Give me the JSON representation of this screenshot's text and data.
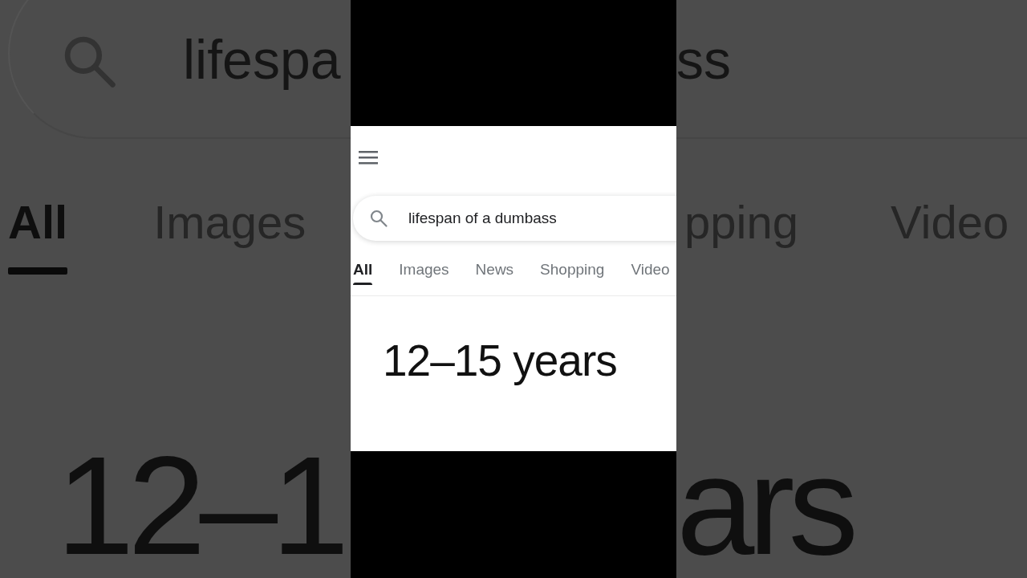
{
  "backdrop": {
    "left": {
      "search": {
        "value": "lifespa"
      },
      "tabs": [
        {
          "label": "All",
          "selected": true
        },
        {
          "label": "Images",
          "selected": false
        }
      ],
      "answer": "12–1"
    },
    "right": {
      "search": {
        "value": "ss"
      },
      "tabs": [
        {
          "label": "pping",
          "selected": false
        },
        {
          "label": "Video",
          "selected": false
        }
      ],
      "answer": "ars"
    }
  },
  "screen": {
    "search": {
      "value": "lifespan of a dumbass"
    },
    "tabs": [
      {
        "label": "All",
        "selected": true
      },
      {
        "label": "Images",
        "selected": false
      },
      {
        "label": "News",
        "selected": false
      },
      {
        "label": "Shopping",
        "selected": false
      },
      {
        "label": "Video",
        "selected": false
      }
    ],
    "answer": "12–15 years"
  }
}
